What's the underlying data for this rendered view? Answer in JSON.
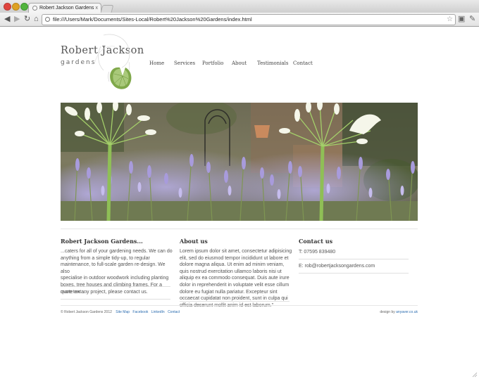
{
  "browser": {
    "tab_title": "Robert Jackson Gardens",
    "tab_close": "x",
    "url": "file:///Users/Mark/Documents/Sites-Local/Robert%20Jackson%20Gardens/index.html",
    "icons": {
      "back": "◀",
      "forward": "▶",
      "reload": "↻",
      "home": "⌂",
      "bookmark": "☆",
      "page_menu": "▣",
      "wrench": "✎"
    }
  },
  "site": {
    "logo_name": "Robert Jackson",
    "logo_sub": "gardens",
    "nav": [
      "Home",
      "Services",
      "Portfolio",
      "About",
      "Testimonials",
      "Contact"
    ]
  },
  "columns": {
    "intro": {
      "heading": "Robert Jackson Gardens...",
      "lines": [
        "...caters for all of your gardening needs. We can do",
        "anything from a simple tidy-up, to regular",
        "maintenance, to full-scale garden re-design. We also",
        "specialise in outdoor woodwork including planting",
        "boxes, tree houses and climbing frames. For a",
        "quote on any project, please contact us."
      ],
      "more": "more text ..."
    },
    "about": {
      "heading": "About us",
      "lines": [
        "Lorem ipsum dolor sit amet, consectetur adipisicing",
        "elit, sed do eiusmod tempor incididunt ut labore et",
        "dolore magna aliqua. Ut enim ad minim veniam,",
        "quis nostrud exercitation ullamco laboris nisi ut",
        "aliquip ex ea commodo consequat. Duis aute irure",
        "dolor in reprehenderit in voluptate velit esse cillum",
        "dolore eu fugiat nulla pariatur. Excepteur sint",
        "occaecat cupidatat non proident, sunt in culpa qui",
        "officia deserunt mollit anim id est laborum.\""
      ]
    },
    "contact": {
      "heading": "Contact us",
      "phone": "T: 07595 839480",
      "email": "E: rob@robertjacksongardens.com"
    }
  },
  "footer": {
    "copyright": "© Robert Jackson Gardens 2012",
    "links": [
      "Site Map",
      "Facebook",
      "LinkedIn",
      "Contact"
    ],
    "design_prefix": "design by",
    "design_link": "anyaver.co.uk"
  },
  "colors": {
    "link": "#2c6db0",
    "lavender": "#a59ad8",
    "leaf_green": "#7fa84a"
  }
}
